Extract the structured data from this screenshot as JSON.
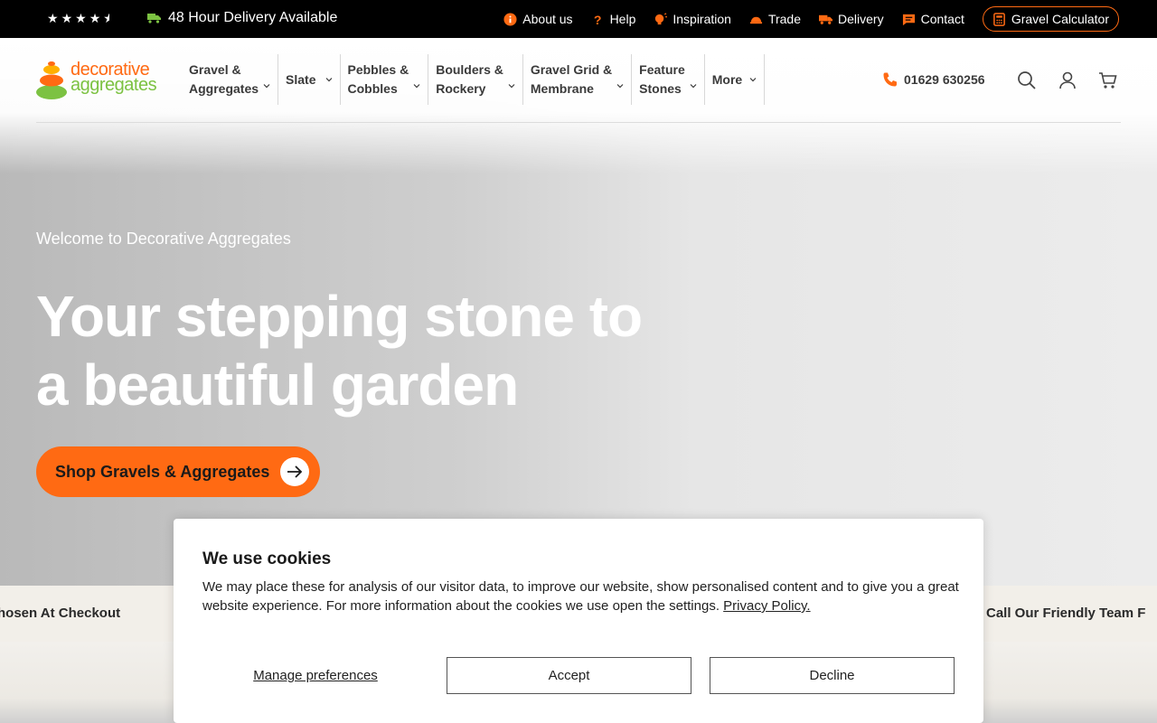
{
  "topbar": {
    "rating_stars": 4.5,
    "delivery_note": "48 Hour Delivery Available",
    "links": [
      {
        "label": "About us",
        "icon": "info-icon"
      },
      {
        "label": "Help",
        "icon": "question-icon"
      },
      {
        "label": "Inspiration",
        "icon": "lightbulb-icon"
      },
      {
        "label": "Trade",
        "icon": "hardhat-icon"
      },
      {
        "label": "Delivery",
        "icon": "truck-icon"
      },
      {
        "label": "Contact",
        "icon": "chat-icon"
      }
    ],
    "calculator_label": "Gravel Calculator"
  },
  "header": {
    "logo_line1": "decorative",
    "logo_line2": "aggregates",
    "nav": [
      {
        "line1": "Gravel &",
        "line2": "Aggregates"
      },
      {
        "line1": "Slate",
        "line2": ""
      },
      {
        "line1": "Pebbles &",
        "line2": "Cobbles"
      },
      {
        "line1": "Boulders &",
        "line2": "Rockery"
      },
      {
        "line1": "Gravel Grid &",
        "line2": "Membrane"
      },
      {
        "line1": "Feature",
        "line2": "Stones"
      },
      {
        "line1": "More",
        "line2": ""
      }
    ],
    "phone": "01629 630256"
  },
  "hero": {
    "eyebrow": "Welcome to Decorative Aggregates",
    "title_line1": "Your stepping stone to",
    "title_line2": "a beautiful garden",
    "cta": "Shop Gravels & Aggregates"
  },
  "strip": {
    "left_text": "hosen At Checkout",
    "right_text": "Call Our Friendly Team F"
  },
  "cookie": {
    "title": "We use cookies",
    "body": "We may place these for analysis of our visitor data, to improve our website, show personalised content and to give you a great website experience. For more information about the cookies we use open the settings.",
    "privacy_link": "Privacy Policy.",
    "manage": "Manage preferences",
    "accept": "Accept",
    "decline": "Decline"
  },
  "colors": {
    "brand_orange": "#ff6a13",
    "brand_green": "#7cc242",
    "topbar_bg": "#000000"
  }
}
